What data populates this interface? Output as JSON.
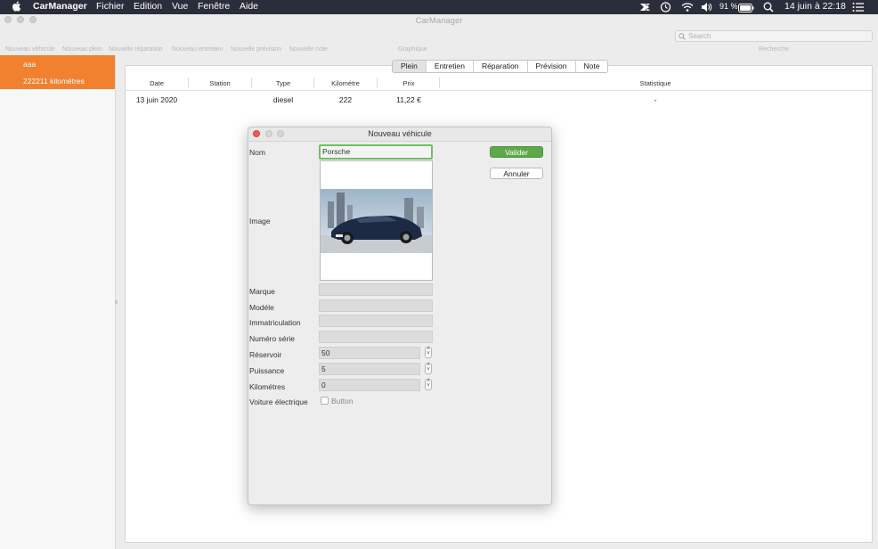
{
  "menubar": {
    "app_name": "CarManager",
    "menus": [
      "Fichier",
      "Edition",
      "Vue",
      "Fenêtre",
      "Aide"
    ],
    "battery": "91 %",
    "datetime": "14 juin à  22:18",
    "icons": [
      "apple-icon",
      "airdrop-icon",
      "time-machine-icon",
      "wifi-icon",
      "volume-icon",
      "battery-icon",
      "spotlight-icon",
      "control-center-icon"
    ]
  },
  "window": {
    "title": "CarManager",
    "toolbar": [
      "Nouveau véhicule",
      "Nouveau plein",
      "Nouvelle réparation",
      "Nouveau entretien",
      "Nouvelle prévision",
      "Nouvelle note"
    ],
    "graphique": "Graphique",
    "search_placeholder": "Search",
    "search_label": "Recherche"
  },
  "sidebar": {
    "vehicles": [
      {
        "name": "aaa",
        "km": "222211 kilométres"
      }
    ]
  },
  "tabs": [
    "Plein",
    "Entretien",
    "Réparation",
    "Prévision",
    "Note"
  ],
  "selected_tab": "Plein",
  "table": {
    "columns": [
      "Date",
      "Station",
      "Type",
      "Kilométre",
      "Prix",
      "Statistique"
    ],
    "rows": [
      {
        "date": "13 juin 2020",
        "station": "",
        "type": "diesel",
        "km": "222",
        "prix": "11,22 €",
        "stat": "-"
      }
    ]
  },
  "dialog": {
    "title": "Nouveau véhicule",
    "labels": {
      "nom": "Nom",
      "image": "Image",
      "marque": "Marque",
      "modele": "Modéle",
      "immat": "Immatriculation",
      "serie": "Numéro série",
      "reservoir": "Réservoir",
      "puissance": "Puissance",
      "km": "Kilométres",
      "electrique": "Voiture électrique"
    },
    "values": {
      "nom": "Porsche",
      "marque": "",
      "modele": "",
      "immat": "",
      "serie": "",
      "reservoir": "50",
      "puissance": "5",
      "km": "0"
    },
    "checkbox_label": "Button",
    "checkbox_checked": false,
    "valider": "Valider",
    "annuler": "Annuler"
  },
  "colors": {
    "menubar": "#2a2e3a",
    "sidebar_selected": "#f1802f",
    "valider": "#5ea84a",
    "focus_ring": "#6fc062"
  }
}
